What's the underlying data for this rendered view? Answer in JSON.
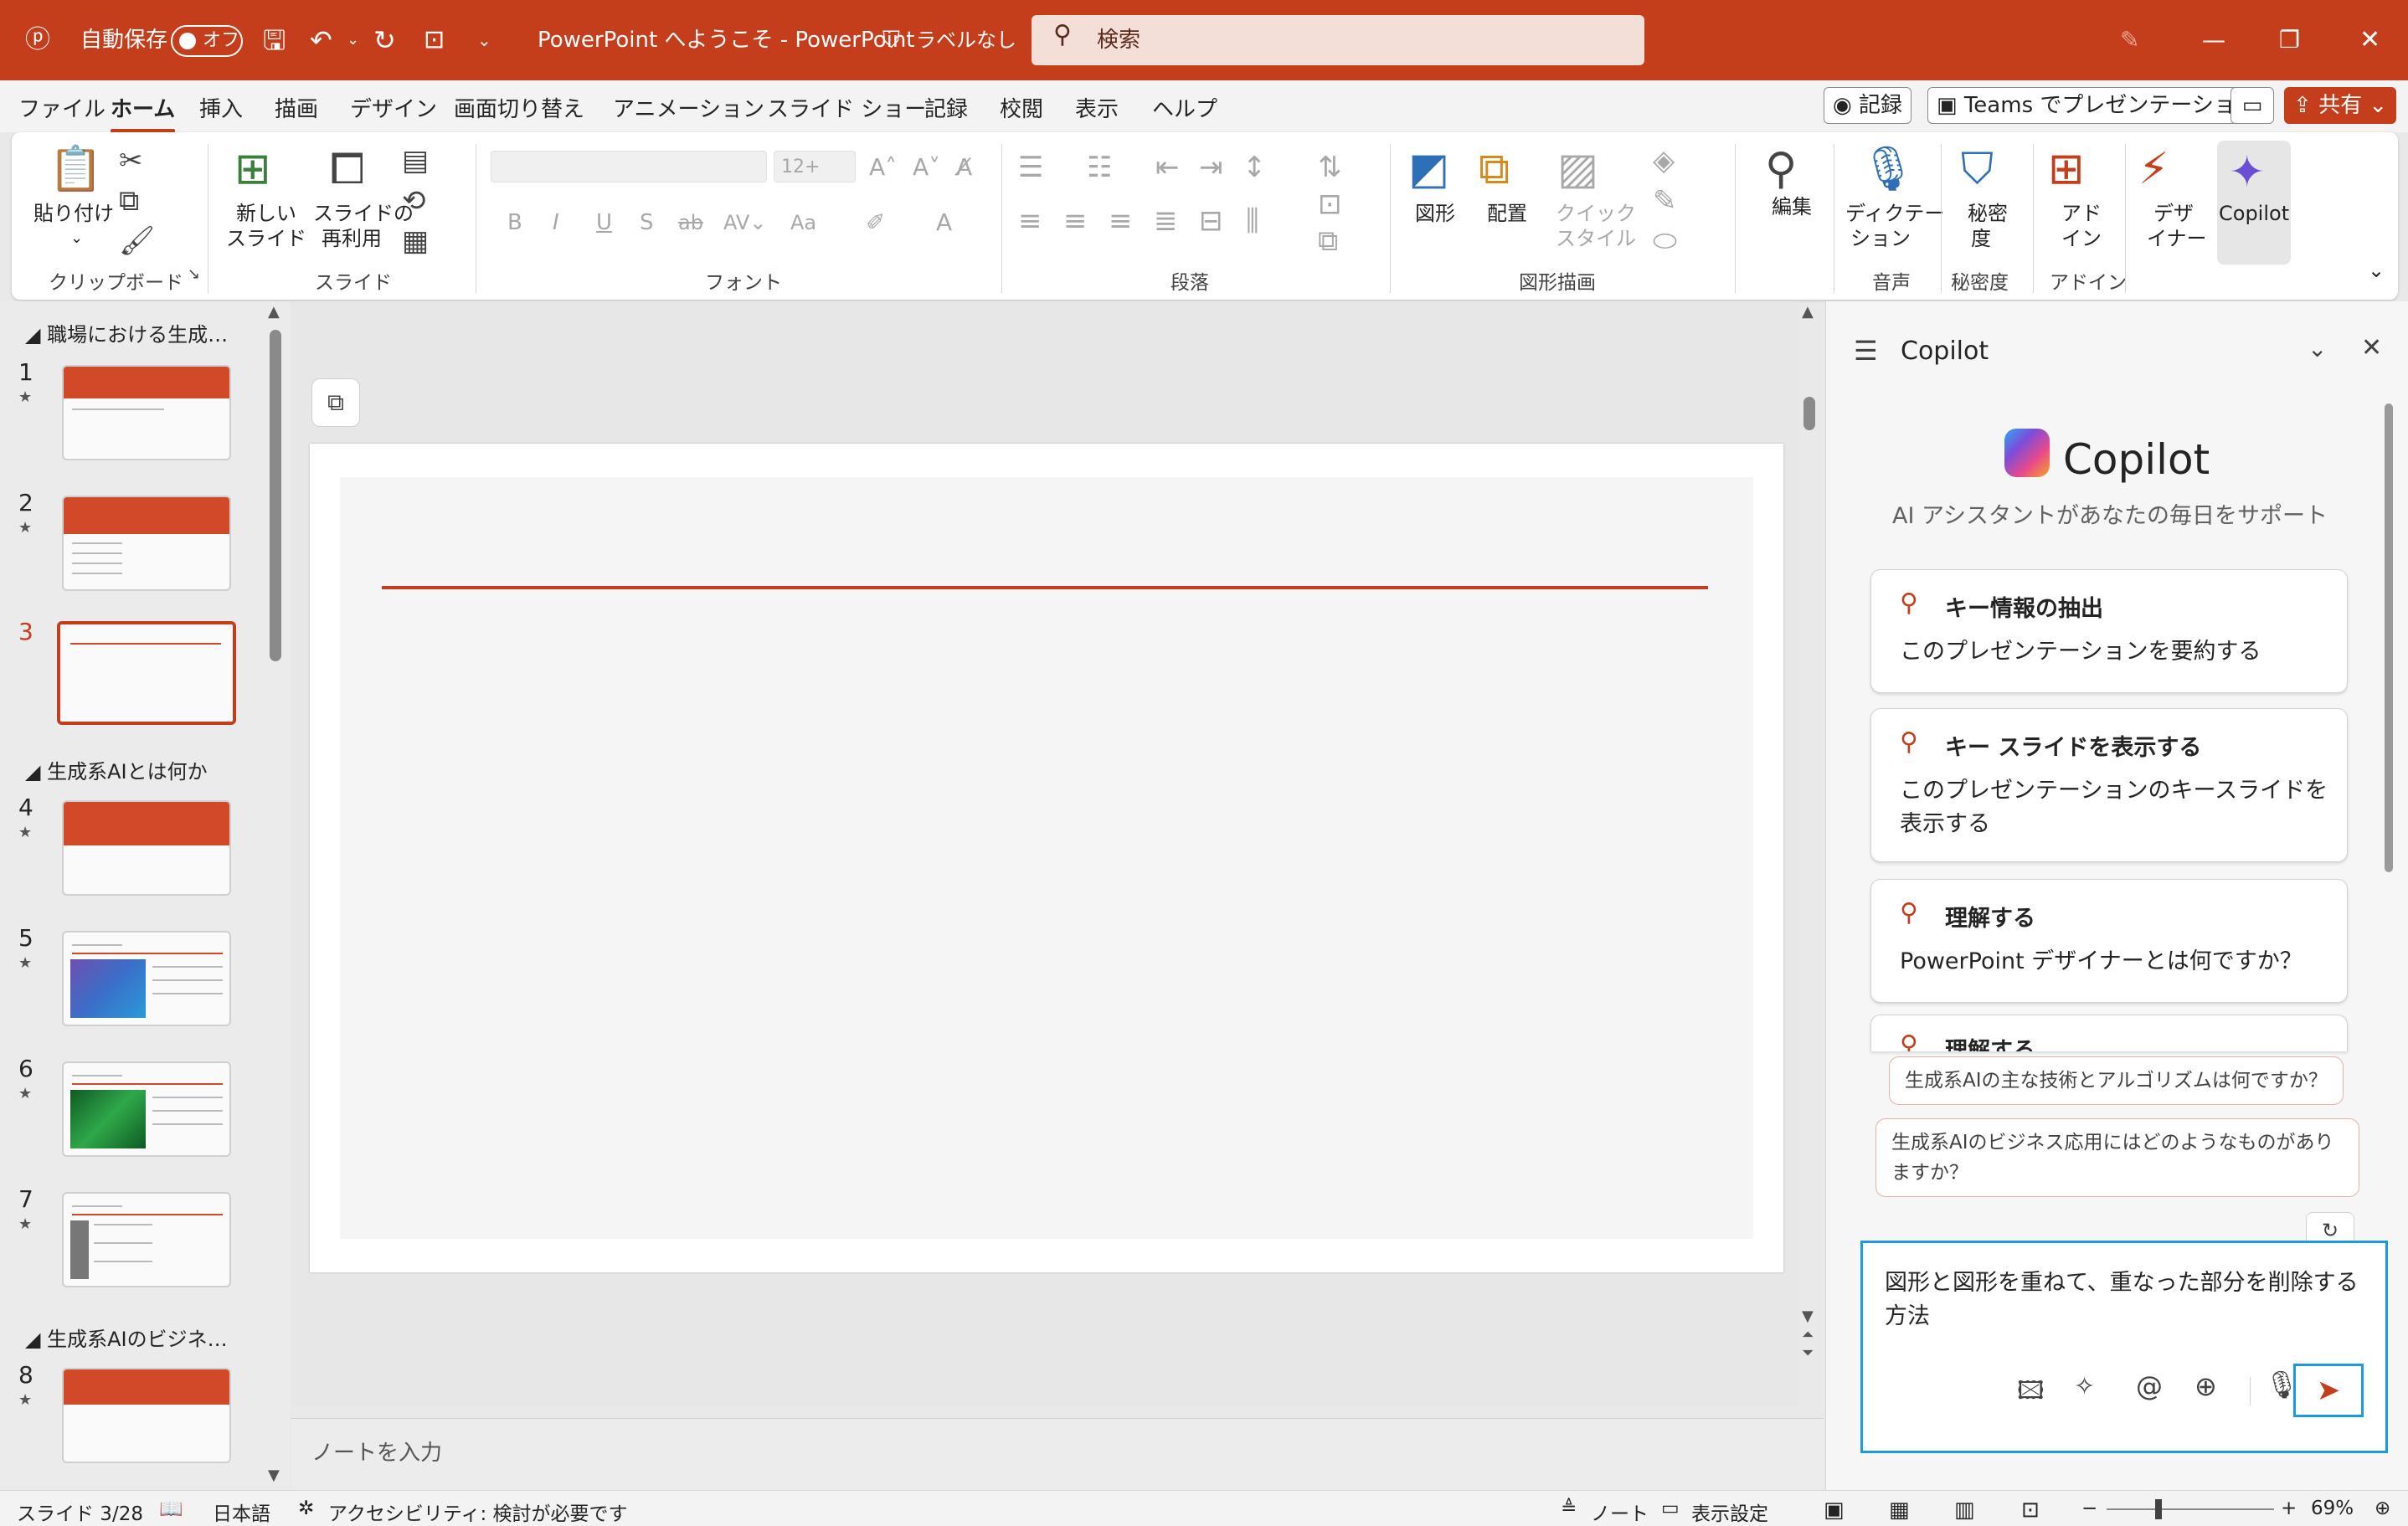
{
  "window": {
    "autosave_label": "自動保存",
    "autosave_state": "オフ",
    "title": "PowerPoint へようこそ  -  PowerPoint",
    "sensitivity": "ラベルなし",
    "search_placeholder": "検索"
  },
  "menu": {
    "items": [
      "ファイル",
      "ホーム",
      "挿入",
      "描画",
      "デザイン",
      "画面切り替え",
      "アニメーション",
      "スライド ショー",
      "記録",
      "校閲",
      "表示",
      "ヘルプ"
    ],
    "active": "ホーム",
    "record_button": "記録",
    "teams_button": "Teams でプレゼンテーション",
    "share_button": "共有"
  },
  "ribbon": {
    "clipboard": {
      "paste": "貼り付け",
      "group": "クリップボード"
    },
    "slides": {
      "new_slide_1": "新しい",
      "new_slide_2": "スライド",
      "reuse_1": "スライドの",
      "reuse_2": "再利用",
      "group": "スライド"
    },
    "font": {
      "font_size": "12+",
      "bold": "B",
      "italic": "I",
      "underline": "U",
      "shadow": "S",
      "strike": "ab",
      "case": "Aa",
      "group": "フォント"
    },
    "paragraph": {
      "group": "段落"
    },
    "drawing": {
      "shapes": "図形",
      "arrange": "配置",
      "quick_1": "クイック",
      "quick_2": "スタイル",
      "group": "図形描画"
    },
    "editing": {
      "label": "編集"
    },
    "voice": {
      "dictate_1": "ディクテー",
      "dictate_2": "ション",
      "group": "音声"
    },
    "sensitivity": {
      "label_1": "秘密",
      "label_2": "度",
      "group": "秘密度"
    },
    "addins": {
      "label_1": "アド",
      "label_2": "イン",
      "group": "アドイン"
    },
    "designer": {
      "label_1": "デザ",
      "label_2": "イナー"
    },
    "copilot": {
      "label": "Copilot"
    }
  },
  "thumbnails": {
    "sections": [
      "職場における生成…",
      "生成系AIとは何か",
      "生成系AIのビジネ…"
    ],
    "slides": [
      {
        "num": "1",
        "title": ""
      },
      {
        "num": "2",
        "title": ""
      },
      {
        "num": "3",
        "title": ""
      },
      {
        "num": "4",
        "title": ""
      },
      {
        "num": "5",
        "title": ""
      },
      {
        "num": "6",
        "title": ""
      },
      {
        "num": "7",
        "title": ""
      },
      {
        "num": "8",
        "title": ""
      }
    ],
    "active_slide": "3"
  },
  "editor": {
    "notes_placeholder": "ノートを入力"
  },
  "copilot": {
    "pane_title": "Copilot",
    "brand": "Copilot",
    "tagline": "AI アシスタントがあなたの毎日をサポート",
    "cards": [
      {
        "title": "キー情報の抽出",
        "body": "このプレゼンテーションを要約する"
      },
      {
        "title": "キー スライドを表示する",
        "body": "このプレゼンテーションのキースライドを表示する"
      },
      {
        "title": "理解する",
        "body": "PowerPoint デザイナーとは何ですか？"
      },
      {
        "title": "理解する",
        "body": ""
      }
    ],
    "suggestions": [
      "生成系AIの主な技術とアルゴリズムは何ですか？",
      "生成系AIのビジネス応用にはどのようなものがありますか？"
    ],
    "composer_text": "図形と図形を重ねて、重なった部分を削除する方法"
  },
  "status": {
    "slide_counter": "スライド 3/28",
    "language": "日本語",
    "accessibility": "アクセシビリティ: 検討が必要です",
    "notes_button": "ノート",
    "display_settings": "表示設定",
    "zoom": "69%",
    "zoom_minus": "−",
    "zoom_plus": "+"
  },
  "colors": {
    "accent": "#c43e1c",
    "focus": "#1a9ae0"
  }
}
